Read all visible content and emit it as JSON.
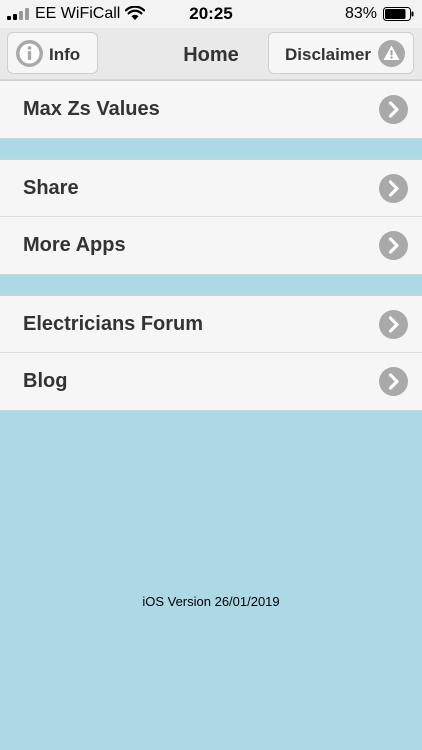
{
  "status_bar": {
    "carrier": "EE WiFiCall",
    "time": "20:25",
    "battery": "83%"
  },
  "header": {
    "title": "Home",
    "info_label": "Info",
    "disclaimer_label": "Disclaimer"
  },
  "menu": {
    "groups": [
      {
        "items": [
          {
            "label": "Max Zs Values"
          }
        ]
      },
      {
        "items": [
          {
            "label": "Share"
          },
          {
            "label": "More Apps"
          }
        ]
      },
      {
        "items": [
          {
            "label": "Electricians Forum"
          },
          {
            "label": "Blog"
          }
        ]
      }
    ]
  },
  "footer": {
    "version": "iOS Version 26/01/2019"
  },
  "colors": {
    "background": "#add8e6",
    "header": "#e9e9e9",
    "row": "#f6f6f6",
    "chevron": "#a9a9a9",
    "text": "#333333"
  },
  "icons": {
    "info": "info-circle-icon",
    "disclaimer": "warning-triangle-icon",
    "chevron": "chevron-right-icon"
  }
}
